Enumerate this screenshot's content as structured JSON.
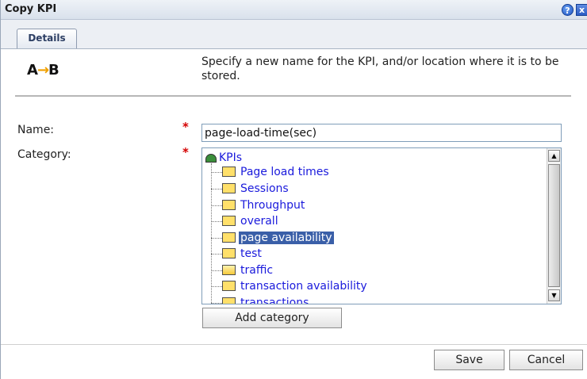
{
  "dialog": {
    "title": "Copy KPI",
    "help_icon": "help-icon",
    "close_icon": "close-icon",
    "help_glyph": "?",
    "close_glyph": "x"
  },
  "tabs": [
    {
      "label": "Details",
      "active": true
    }
  ],
  "logo": {
    "icon": "ab-logo-icon"
  },
  "description": "Specify a new name for the KPI, and/or location where it is to be stored.",
  "form": {
    "name_label": "Name:",
    "category_label": "Category:",
    "required_marker": "*",
    "name_value": "page-load-time(sec)"
  },
  "tree": {
    "root": {
      "label": "KPIs",
      "icon": "kpi-gauge-icon"
    },
    "items": [
      {
        "label": "Page load times",
        "icon": "folder-icon",
        "selected": false
      },
      {
        "label": "Sessions",
        "icon": "folder-icon",
        "selected": false
      },
      {
        "label": "Throughput",
        "icon": "folder-icon",
        "selected": false
      },
      {
        "label": "overall",
        "icon": "folder-icon",
        "selected": false
      },
      {
        "label": "page availability",
        "icon": "folder-icon",
        "selected": true
      },
      {
        "label": "test",
        "icon": "folder-icon",
        "selected": false
      },
      {
        "label": "traffic",
        "icon": "folder-open-icon",
        "selected": false
      },
      {
        "label": "transaction availability",
        "icon": "folder-icon",
        "selected": false
      },
      {
        "label": "transactions",
        "icon": "folder-icon",
        "selected": false
      }
    ]
  },
  "buttons": {
    "add_category": "Add category",
    "save": "Save",
    "cancel": "Cancel"
  },
  "colors": {
    "link": "#1a1adc",
    "selection": "#3a5fa8",
    "required": "#d40000"
  }
}
